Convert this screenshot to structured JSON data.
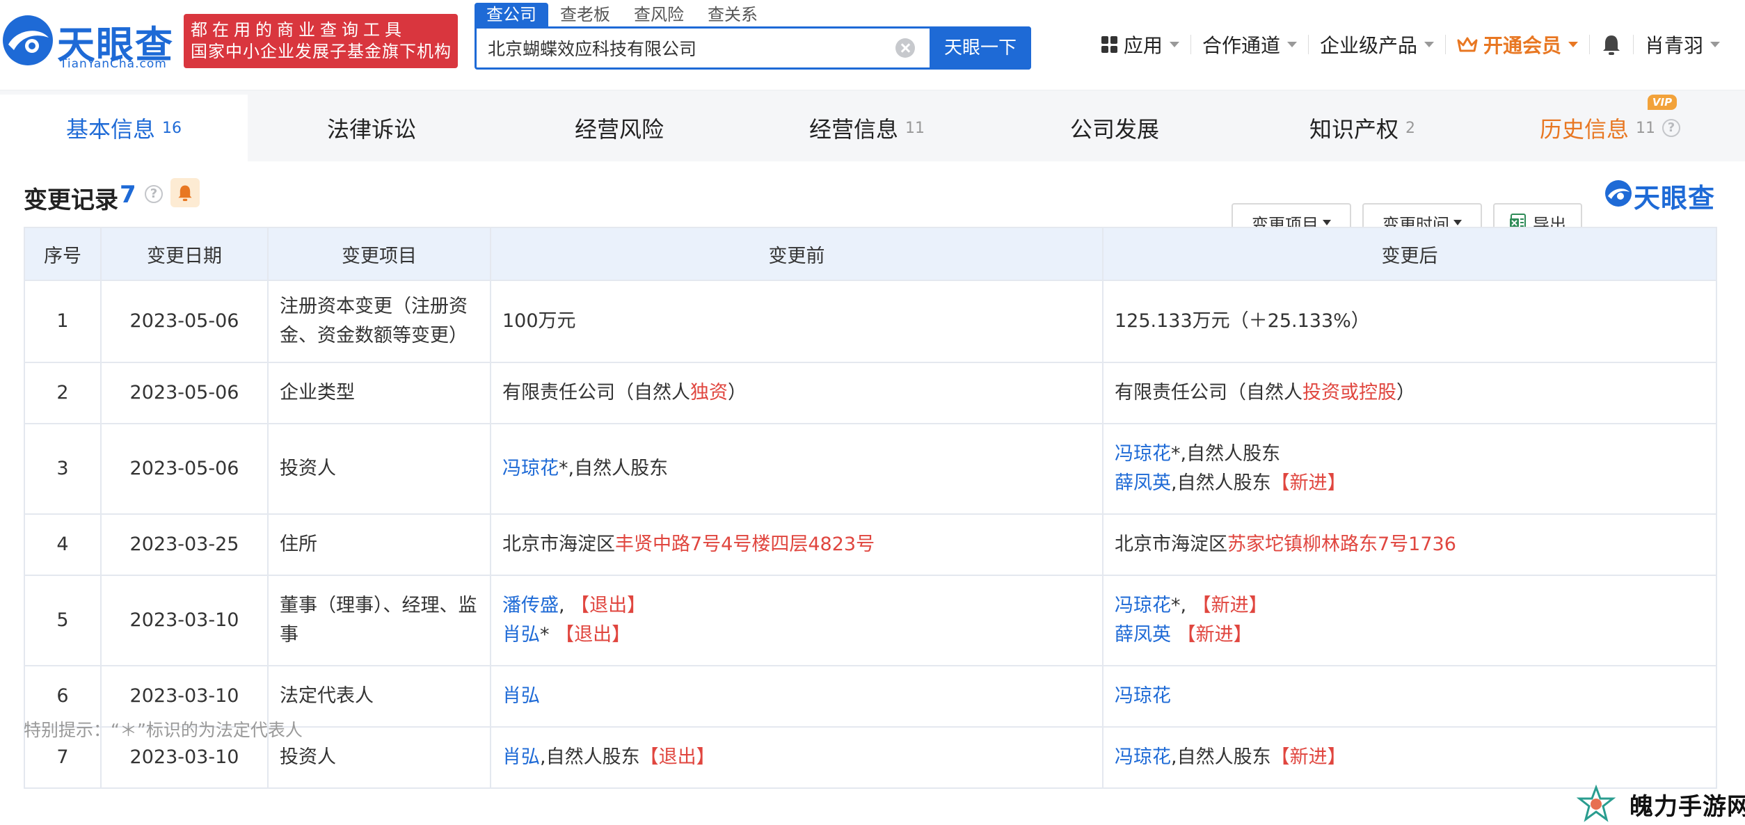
{
  "brand": {
    "name": "天眼查",
    "url": "TianYanCha.com",
    "slogan_line1": "都在用的商业查询工具",
    "slogan_line2": "国家中小企业发展子基金旗下机构",
    "accent_color": "#1e6ad6",
    "slogan_color": "#d9363e"
  },
  "search": {
    "tabs": [
      "查公司",
      "查老板",
      "查风险",
      "查关系"
    ],
    "active_tab": "查公司",
    "value": "北京蝴蝶效应科技有限公司",
    "button_label": "天眼一下"
  },
  "nav": {
    "apps": "应用",
    "channel": "合作通道",
    "enterprise": "企业级产品",
    "vip": "开通会员",
    "user": "肖青羽",
    "vip_color": "#e87722"
  },
  "tabs": [
    {
      "label": "基本信息",
      "count": "16"
    },
    {
      "label": "法律诉讼",
      "count": ""
    },
    {
      "label": "经营风险",
      "count": ""
    },
    {
      "label": "经营信息",
      "count": "11"
    },
    {
      "label": "公司发展",
      "count": ""
    },
    {
      "label": "知识产权",
      "count": "2"
    },
    {
      "label": "历史信息",
      "count": "11",
      "badge": "VIP"
    }
  ],
  "section": {
    "title": "变更记录",
    "count": "7",
    "filter_item": "变更项目",
    "filter_time": "变更时间",
    "export": "导出",
    "brand_mark": "天眼查"
  },
  "table": {
    "headers": [
      "序号",
      "变更日期",
      "变更项目",
      "变更前",
      "变更后"
    ],
    "rows": [
      {
        "no": "1",
        "date": "2023-05-06",
        "item": "注册资本变更（注册资金、资金数额等变更）",
        "before": {
          "text": "100万元"
        },
        "after": {
          "text": "125.133万元（＋25.133%）"
        }
      },
      {
        "no": "2",
        "date": "2023-05-06",
        "item": "企业类型",
        "before": {
          "prefix": "有限责任公司（自然人",
          "highlight": "独资",
          "suffix": "）"
        },
        "after": {
          "prefix": "有限责任公司（自然人",
          "highlight": "投资或控股",
          "suffix": "）"
        }
      },
      {
        "no": "3",
        "date": "2023-05-06",
        "item": "投资人",
        "before": {
          "name": "冯琼花",
          "rest": "*,自然人股东"
        },
        "after": {
          "name1": "冯琼花",
          "rest1": "*,自然人股东",
          "name2": "薛凤英",
          "rest2": ",自然人股东",
          "tag2": "【新进】"
        }
      },
      {
        "no": "4",
        "date": "2023-03-25",
        "item": "住所",
        "before": {
          "prefix": "北京市海淀区",
          "highlight": "丰贤中路7号4号楼四层4823号"
        },
        "after": {
          "prefix": "北京市海淀区",
          "highlight": "苏家坨镇柳林路东7号1736"
        }
      },
      {
        "no": "5",
        "date": "2023-03-10",
        "item": "董事（理事）、经理、监事",
        "before": {
          "name1": "潘传盛",
          "rest1": ", ",
          "tag1": "【退出】",
          "name2": "肖弘",
          "rest2": "* ",
          "tag2": "【退出】"
        },
        "after": {
          "name1": "冯琼花",
          "rest1": "*, ",
          "tag1": "【新进】",
          "name2": "薛凤英",
          "rest2": " ",
          "tag2": "【新进】"
        }
      },
      {
        "no": "6",
        "date": "2023-03-10",
        "item": "法定代表人",
        "before": {
          "name": "肖弘"
        },
        "after": {
          "name": "冯琼花"
        }
      },
      {
        "no": "7",
        "date": "2023-03-10",
        "item": "投资人",
        "before": {
          "name": "肖弘",
          "rest": ",自然人股东",
          "tag": "【退出】"
        },
        "after": {
          "name": "冯琼花",
          "rest": ",自然人股东",
          "tag": "【新进】"
        }
      }
    ]
  },
  "footnote": "特别提示：“＊”标识的为法定代表人",
  "watermark": "魄力手游网"
}
